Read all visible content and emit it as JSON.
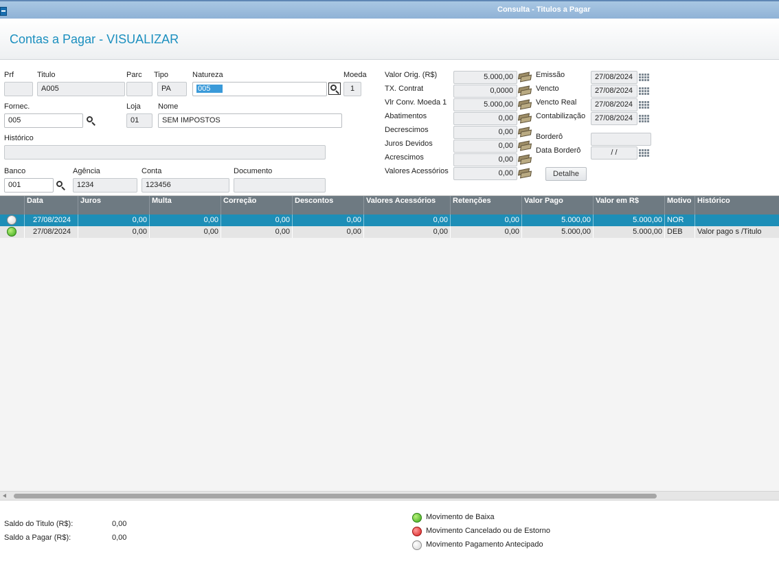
{
  "window": {
    "title": "Consulta - Titulos a Pagar"
  },
  "page": {
    "title": "Contas a Pagar - VISUALIZAR"
  },
  "form": {
    "prf": {
      "label": "Prf",
      "value": ""
    },
    "titulo": {
      "label": "Titulo",
      "value": "A005"
    },
    "parc": {
      "label": "Parc",
      "value": ""
    },
    "tipo": {
      "label": "Tipo",
      "value": "PA"
    },
    "natureza": {
      "label": "Natureza",
      "value": "005"
    },
    "moeda": {
      "label": "Moeda",
      "value": "1"
    },
    "fornec": {
      "label": "Fornec.",
      "value": "005"
    },
    "loja": {
      "label": "Loja",
      "value": "01"
    },
    "nome": {
      "label": "Nome",
      "value": "SEM IMPOSTOS"
    },
    "historico": {
      "label": "Histórico",
      "value": ""
    },
    "banco": {
      "label": "Banco",
      "value": "001"
    },
    "agencia": {
      "label": "Agência",
      "value": "1234"
    },
    "conta": {
      "label": "Conta",
      "value": "123456"
    },
    "documento": {
      "label": "Documento",
      "value": ""
    }
  },
  "values": [
    {
      "label": "Valor Orig. (R$)",
      "value": "5.000,00"
    },
    {
      "label": "TX. Contrat",
      "value": "0,0000"
    },
    {
      "label": "Vlr Conv. Moeda 1",
      "value": "5.000,00"
    },
    {
      "label": "Abatimentos",
      "value": "0,00"
    },
    {
      "label": "Decrescimos",
      "value": "0,00"
    },
    {
      "label": "Juros Devidos",
      "value": "0,00"
    },
    {
      "label": "Acrescimos",
      "value": "0,00"
    },
    {
      "label": "Valores Acessórios",
      "value": "0,00"
    }
  ],
  "dates": {
    "emissao": {
      "label": "Emissão",
      "value": "27/08/2024"
    },
    "vencto": {
      "label": "Vencto",
      "value": "27/08/2024"
    },
    "vencto_real": {
      "label": "Vencto Real",
      "value": "27/08/2024"
    },
    "contabilizacao": {
      "label": "Contabilização",
      "value": "27/08/2024"
    },
    "bordero": {
      "label": "Borderô",
      "value": ""
    },
    "data_bordero": {
      "label": "Data Borderô",
      "value": " /  /"
    }
  },
  "buttons": {
    "detalhe": "Detalhe"
  },
  "table": {
    "columns": [
      "Data",
      "Juros",
      "Multa",
      "Correção",
      "Descontos",
      "Valores Acessórios",
      "Retenções",
      "Valor Pago",
      "Valor em R$",
      "Motivo",
      "Histórico"
    ],
    "rows": [
      {
        "status": "white",
        "data": "27/08/2024",
        "juros": "0,00",
        "multa": "0,00",
        "correcao": "0,00",
        "descontos": "0,00",
        "valores_acessorios": "0,00",
        "retencoes": "0,00",
        "valor_pago": "5.000,00",
        "valor_rs": "5.000,00",
        "motivo": "NOR",
        "historico": ""
      },
      {
        "status": "green",
        "data": "27/08/2024",
        "juros": "0,00",
        "multa": "0,00",
        "correcao": "0,00",
        "descontos": "0,00",
        "valores_acessorios": "0,00",
        "retencoes": "0,00",
        "valor_pago": "5.000,00",
        "valor_rs": "5.000,00",
        "motivo": "DEB",
        "historico": "Valor pago s /Titulo"
      }
    ]
  },
  "footer": {
    "saldo_titulo": {
      "label": "Saldo do Titulo (R$):",
      "value": "0,00"
    },
    "saldo_pagar": {
      "label": "Saldo a Pagar (R$):",
      "value": "0,00"
    },
    "legend": [
      {
        "color": "green",
        "label": "Movimento de Baixa"
      },
      {
        "color": "red",
        "label": "Movimento Cancelado ou de Estorno"
      },
      {
        "color": "white",
        "label": "Movimento Pagamento Antecipado"
      }
    ]
  }
}
